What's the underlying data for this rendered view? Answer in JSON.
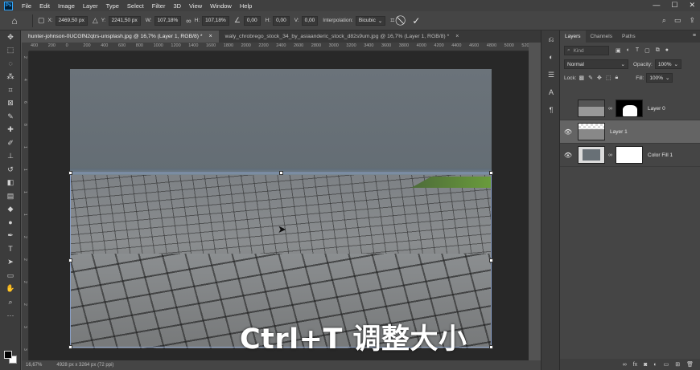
{
  "app": {
    "logo": "Ps"
  },
  "menu": [
    "File",
    "Edit",
    "Image",
    "Layer",
    "Type",
    "Select",
    "Filter",
    "3D",
    "View",
    "Window",
    "Help"
  ],
  "window_controls": [
    "—",
    "☐",
    "✕"
  ],
  "options": {
    "x_label": "X:",
    "x_value": "2469,50 px",
    "y_label": "Y:",
    "y_value": "2241,50 px",
    "w_label": "W:",
    "w_value": "107,18%",
    "h_label": "H:",
    "h_value": "107,18%",
    "angle_value": "0,00",
    "hskew_label": "H:",
    "hskew_value": "0,00",
    "vskew_label": "V:",
    "vskew_value": "0,00",
    "interp_label": "Interpolation:",
    "interp_value": "Bicubic"
  },
  "tabs": [
    {
      "title": "hunter-johnson-0UCGfN2qtrs-unsplash.jpg @ 16,7% (Layer 1, RGB/8) *",
      "close": "×"
    },
    {
      "title": "waly_chrobrego_stock_34_by_asiaanderic_stock_d82s9um.jpg @ 16,7% (Layer 1, RGB/8) *",
      "close": "×"
    }
  ],
  "ruler_h": [
    "400",
    "200",
    "0",
    "200",
    "400",
    "600",
    "800",
    "1000",
    "1200",
    "1400",
    "1600",
    "1800",
    "2000",
    "2200",
    "2400",
    "2600",
    "2800",
    "3000",
    "3200",
    "3400",
    "3600",
    "3800",
    "4000",
    "4200",
    "4400",
    "4600",
    "4800",
    "5000",
    "5200"
  ],
  "ruler_v": [
    "2",
    "4",
    "6",
    "8",
    "1",
    "1",
    "1",
    "1",
    "2",
    "2",
    "2",
    "2",
    "3",
    "3"
  ],
  "subtitle": "Ctrl+T 调整大小",
  "status": {
    "zoom": "16,67%",
    "doc_info": "4928 px x 3264 px (72 ppi)"
  },
  "panel": {
    "tabs": [
      "Layers",
      "Channels",
      "Paths"
    ],
    "kind_label": "Kind",
    "blend_mode": "Normal",
    "opacity_label": "Opacity:",
    "opacity_value": "100%",
    "lock_label": "Lock:",
    "fill_label": "Fill:",
    "fill_value": "100%",
    "layers": [
      {
        "name": "Layer 0",
        "visible": false
      },
      {
        "name": "Layer 1",
        "visible": true
      },
      {
        "name": "Color Fill 1",
        "visible": true
      }
    ]
  },
  "colors": {
    "accent": "#31a8ff",
    "canvas_bg": "#282828",
    "sky": "#687076"
  }
}
